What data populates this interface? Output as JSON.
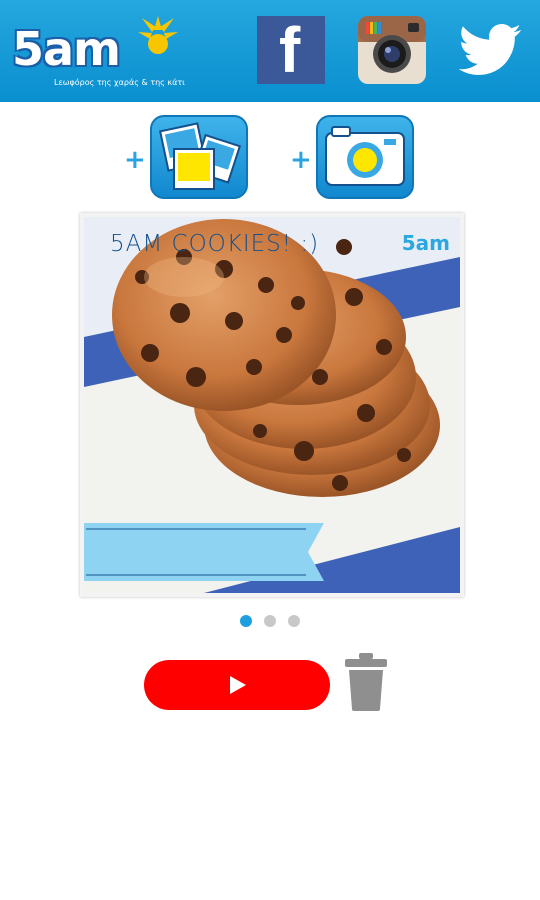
{
  "header": {
    "logo_text": "5am",
    "logo_tagline": "Lεωφόρος της χαράς & της κάτι",
    "social": [
      {
        "name": "facebook",
        "icon": "facebook-icon"
      },
      {
        "name": "instagram",
        "icon": "instagram-icon"
      },
      {
        "name": "twitter",
        "icon": "twitter-icon"
      }
    ]
  },
  "actions": {
    "plus_symbol": "+",
    "add_gallery_icon": "gallery-icon",
    "add_camera_icon": "camera-icon"
  },
  "photo": {
    "caption": "5AM COOKIES! :)",
    "watermark": "5am"
  },
  "pager": {
    "active_index": 0,
    "count": 3,
    "active_color": "#1ea0e0",
    "inactive_color": "#c8c8c8"
  },
  "controls": {
    "play_icon": "play-icon",
    "delete_icon": "trash-icon",
    "play_color": "#ff0000"
  },
  "colors": {
    "header_blue": "#0a8fcf",
    "accent_blue": "#2aa4e0",
    "facebook_blue": "#3b5998",
    "trash_gray": "#8f8f8f"
  }
}
